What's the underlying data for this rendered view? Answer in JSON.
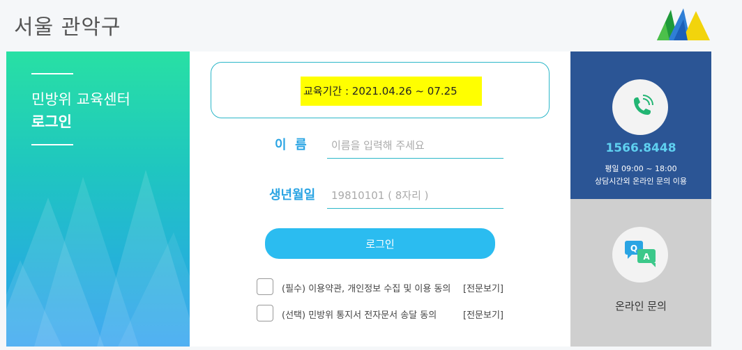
{
  "header": {
    "title": "서울 관악구"
  },
  "left_panel": {
    "title": "민방위 교육센터",
    "subtitle": "로그인"
  },
  "main": {
    "period": "교육기간 : 2021.04.26 ~ 07.25",
    "name_label": "이  름",
    "name_placeholder": "이름을 입력해 주세요",
    "birth_label": "생년월일",
    "birth_placeholder": "19810101 ( 8자리 )",
    "login_label": "로그인",
    "agreements": [
      {
        "text": "(필수) 이용약관, 개인정보 수집 및 이용 동의",
        "view": "[전문보기]"
      },
      {
        "text": "(선택) 민방위 통지서 전자문서 송달 동의",
        "view": "[전문보기]"
      }
    ]
  },
  "contact": {
    "phone": "1566.8448",
    "hours_line1": "평일 09:00 ~ 18:00",
    "hours_line2": "상담시간외 온라인 문의 이용",
    "icon": "phone-icon"
  },
  "online": {
    "label": "온라인 문의",
    "icon": "qa-chat-icon"
  },
  "colors": {
    "accent": "#2bbcf0",
    "navy": "#2b5595",
    "highlight": "#ffff00"
  }
}
